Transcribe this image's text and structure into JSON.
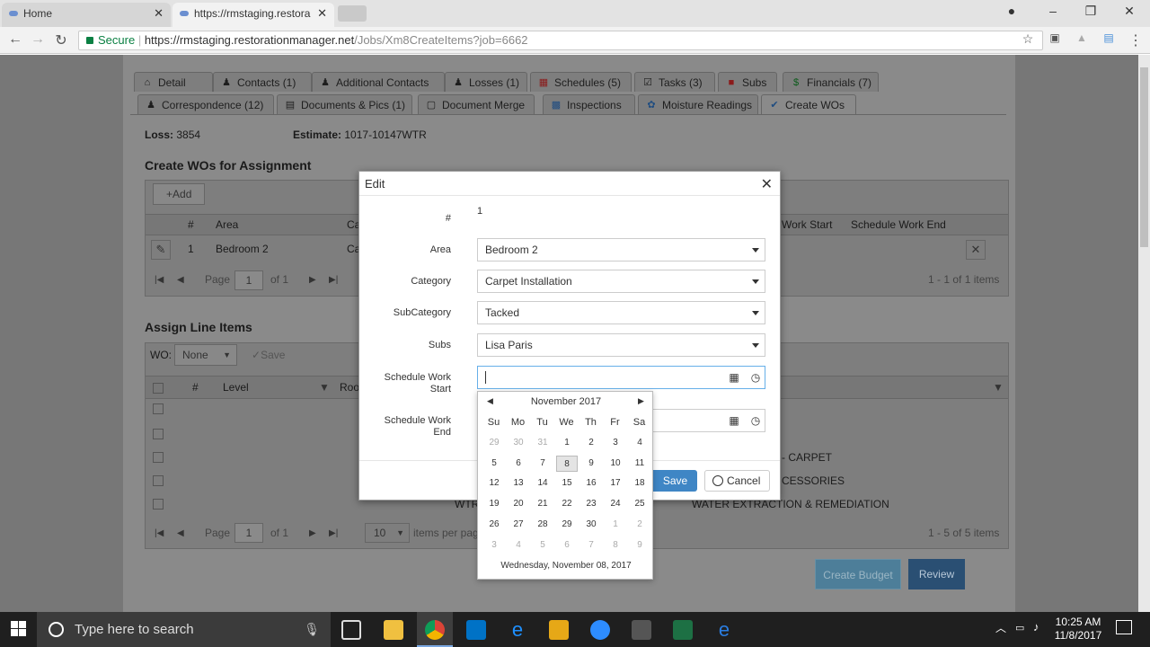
{
  "browser": {
    "tabs": [
      {
        "label": "Home"
      },
      {
        "label": "https://rmstaging.restora"
      }
    ],
    "secure_label": "Secure",
    "url_host": "https://rmstaging.restorationmanager.net",
    "url_path": "/Jobs/Xm8CreateItems?job=6662"
  },
  "job_tabs_row1": [
    {
      "label": "Detail",
      "icon": "home-icon"
    },
    {
      "label": "Contacts (1)",
      "icon": "person-icon"
    },
    {
      "label": "Additional Contacts",
      "icon": "person-icon"
    },
    {
      "label": "Losses (1)",
      "icon": "person-icon"
    },
    {
      "label": "Schedules (5)",
      "icon": "calendar-icon"
    },
    {
      "label": "Tasks (3)",
      "icon": "checklist-icon"
    },
    {
      "label": "Subs",
      "icon": "truck-icon"
    },
    {
      "label": "Financials (7)",
      "icon": "dollar-icon"
    }
  ],
  "job_tabs_row2": [
    {
      "label": "Correspondence (12)",
      "icon": "people-icon"
    },
    {
      "label": "Documents & Pics (1)",
      "icon": "document-icon"
    },
    {
      "label": "Document Merge",
      "icon": "merge-icon"
    },
    {
      "label": "Inspections",
      "icon": "inspection-icon"
    },
    {
      "label": "Moisture Readings",
      "icon": "droplets-icon"
    },
    {
      "label": "Create WOs",
      "icon": "check-circle-icon"
    }
  ],
  "summary": {
    "loss_label": "Loss:",
    "loss_value": "3854",
    "estimate_label": "Estimate:",
    "estimate_value": "1017-10147WTR"
  },
  "create_wos": {
    "title": "Create WOs for Assignment",
    "add_label": "Add",
    "columns": [
      "#",
      "Area",
      "Ca",
      "Work Start",
      "Schedule Work End"
    ],
    "row": {
      "num": "1",
      "area": "Bedroom 2",
      "cat": "Ca"
    },
    "pager": {
      "page_label": "Page",
      "page": "1",
      "of": "of 1",
      "summary": "1 - 1 of 1 items"
    }
  },
  "assign": {
    "title": "Assign Line Items",
    "wo_label": "WO:",
    "wo_value": "None",
    "save_label": "Save",
    "columns": [
      "#",
      "Level",
      "Roo"
    ],
    "rows": [
      "- CARPET",
      "CESSORIES",
      "WATER EXTRACTION & REMEDIATION"
    ],
    "row_prefix": "WTR",
    "pager": {
      "page_label": "Page",
      "page": "1",
      "of": "of 1",
      "size": "10",
      "per_page": "items per pag",
      "summary": "1 - 5 of 5 items"
    }
  },
  "modal": {
    "title": "Edit",
    "num_label": "#",
    "num_value": "1",
    "area_label": "Area",
    "area_value": "Bedroom 2",
    "category_label": "Category",
    "category_value": "Carpet Installation",
    "subcategory_label": "SubCategory",
    "subcategory_value": "Tacked",
    "subs_label": "Subs",
    "subs_value": "Lisa Paris",
    "start_label_1": "Schedule Work",
    "start_label_2": "Start",
    "end_label_1": "Schedule Work",
    "end_label_2": "End",
    "save_label": "Save",
    "cancel_label": "Cancel"
  },
  "calendar": {
    "month": "November 2017",
    "weekdays": [
      "Su",
      "Mo",
      "Tu",
      "We",
      "Th",
      "Fr",
      "Sa"
    ],
    "weeks": [
      [
        "29",
        "30",
        "31",
        "1",
        "2",
        "3",
        "4"
      ],
      [
        "5",
        "6",
        "7",
        "8",
        "9",
        "10",
        "11"
      ],
      [
        "12",
        "13",
        "14",
        "15",
        "16",
        "17",
        "18"
      ],
      [
        "19",
        "20",
        "21",
        "22",
        "23",
        "24",
        "25"
      ],
      [
        "26",
        "27",
        "28",
        "29",
        "30",
        "1",
        "2"
      ],
      [
        "3",
        "4",
        "5",
        "6",
        "7",
        "8",
        "9"
      ]
    ],
    "selected": "8",
    "footer": "Wednesday, November 08, 2017"
  },
  "actions": {
    "create_budget": "Create Budget",
    "review": "Review"
  },
  "taskbar": {
    "search_placeholder": "Type here to search",
    "time": "10:25 AM",
    "date": "11/8/2017"
  }
}
